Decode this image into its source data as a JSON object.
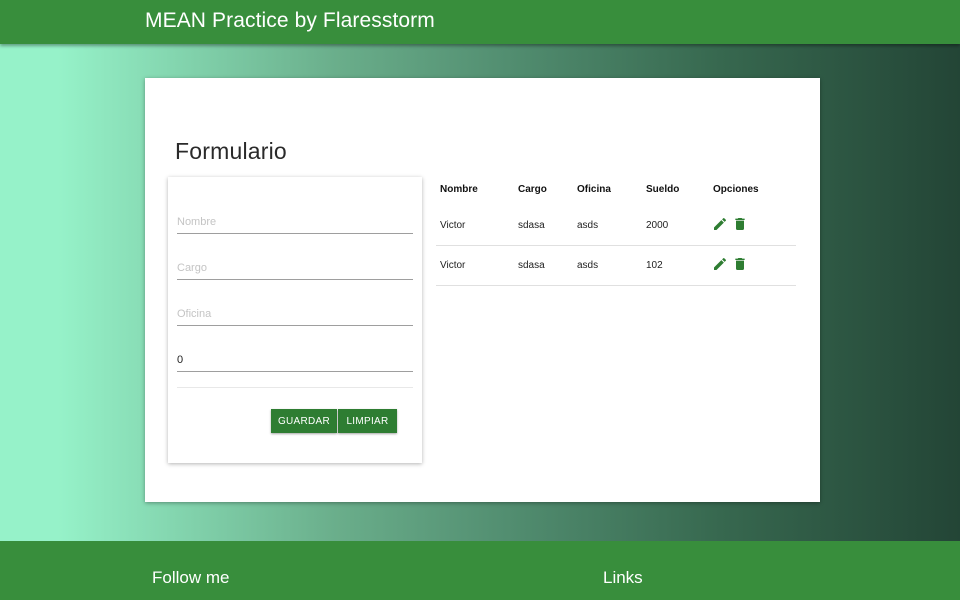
{
  "navbar": {
    "title": "MEAN Practice by Flaresstorm"
  },
  "form": {
    "title": "Formulario",
    "fields": {
      "nombre": {
        "placeholder": "Nombre",
        "value": ""
      },
      "cargo": {
        "placeholder": "Cargo",
        "value": ""
      },
      "oficina": {
        "placeholder": "Oficina",
        "value": ""
      },
      "sueldo": {
        "placeholder": "",
        "value": "0"
      }
    },
    "buttons": {
      "save": "GUARDAR",
      "clear": "LIMPIAR"
    }
  },
  "table": {
    "headers": [
      "Nombre",
      "Cargo",
      "Oficina",
      "Sueldo",
      "Opciones"
    ],
    "rows": [
      {
        "nombre": "Victor",
        "cargo": "sdasa",
        "oficina": "asds",
        "sueldo": "2000"
      },
      {
        "nombre": "Victor",
        "cargo": "sdasa",
        "oficina": "asds",
        "sueldo": "102"
      }
    ],
    "icons": {
      "edit": "pencil-icon",
      "delete": "trash-icon"
    }
  },
  "footer": {
    "left": {
      "heading": "Follow me",
      "text": ""
    },
    "right": {
      "heading": "Links",
      "text": ""
    }
  },
  "colors": {
    "primary": "#388e3c",
    "button": "#2e7d32",
    "gradient_start": "#96f2c9",
    "gradient_end": "#234536"
  }
}
